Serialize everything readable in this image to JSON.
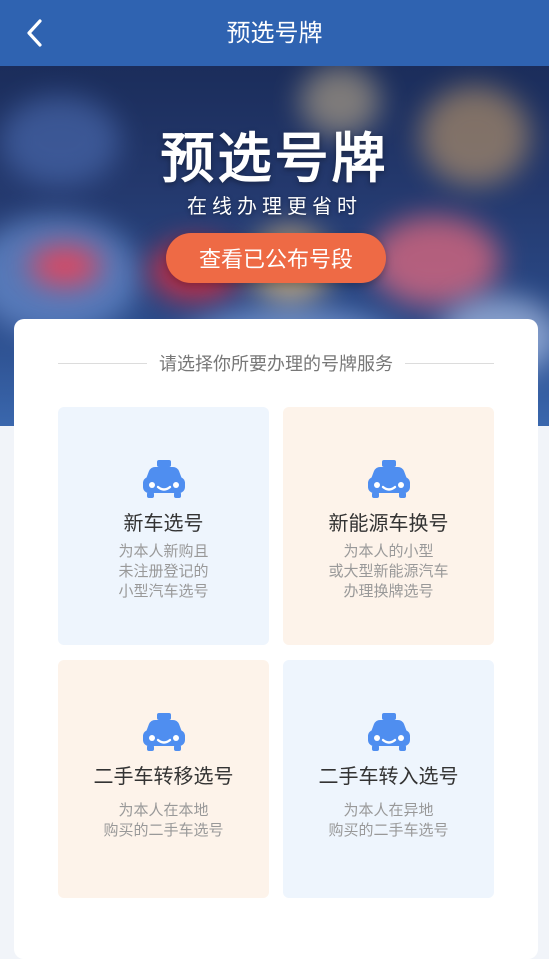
{
  "navbar": {
    "title": "预选号牌"
  },
  "hero": {
    "title": "预选号牌",
    "subtitle": "在线办理更省时",
    "button_label": "查看已公布号段"
  },
  "section": {
    "heading": "请选择你所要办理的号牌服务"
  },
  "cards": [
    {
      "title": "新车选号",
      "desc": [
        "为本人新购且",
        "未注册登记的",
        "小型汽车选号"
      ],
      "theme": "blue"
    },
    {
      "title": "新能源车换号",
      "desc": [
        "为本人的小型",
        "或大型新能源汽车",
        "办理换牌选号"
      ],
      "theme": "orange"
    },
    {
      "title": "二手车转移选号",
      "desc": [
        "为本人在本地",
        "购买的二手车选号"
      ],
      "theme": "orange"
    },
    {
      "title": "二手车转入选号",
      "desc": [
        "为本人在异地",
        "购买的二手车选号"
      ],
      "theme": "blue"
    }
  ],
  "colors": {
    "navbar": "#2f63b1",
    "accent_button": "#ee6a45",
    "icon_blue": "#4f8ef0",
    "card_blue": "#eef5fd",
    "card_orange": "#fdf3ea"
  },
  "icons": {
    "back": "chevron-left-icon",
    "card": "taxi-car-icon"
  }
}
